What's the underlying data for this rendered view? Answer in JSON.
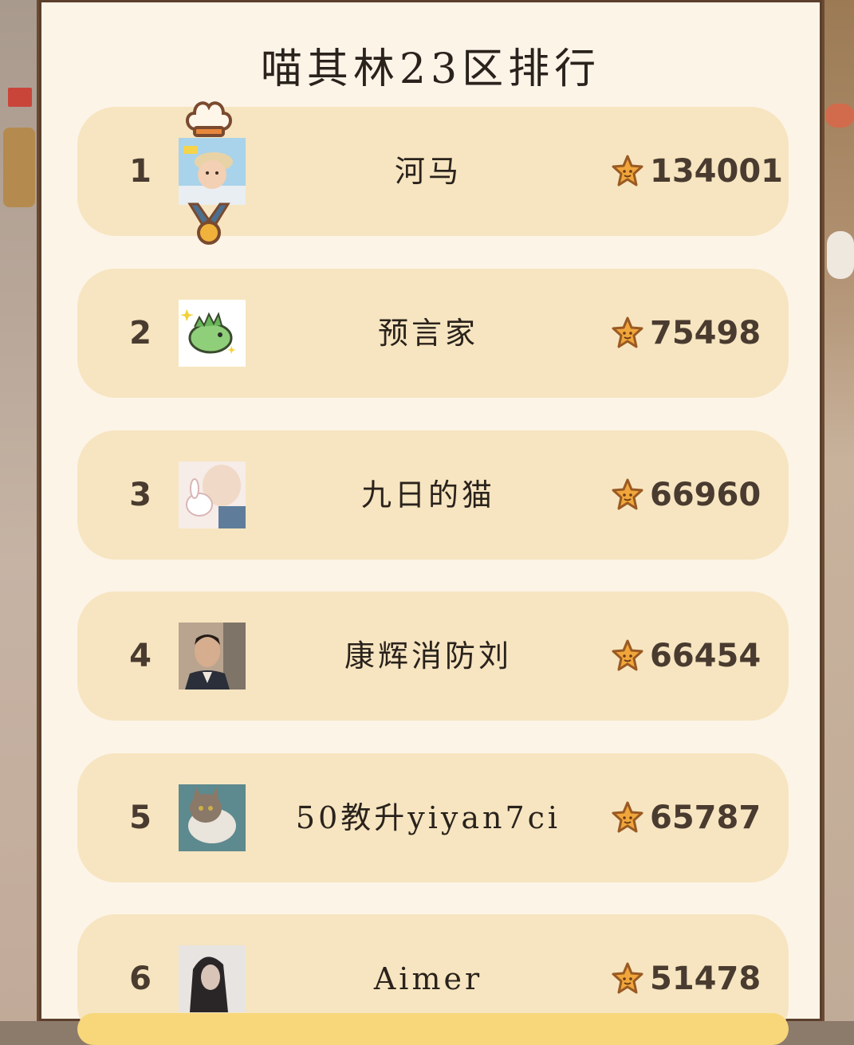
{
  "leaderboard": {
    "title": "喵其林23区排行",
    "entries": [
      {
        "rank": "1",
        "name": "河马",
        "score": "134001",
        "avatar": "baby-photo"
      },
      {
        "rank": "2",
        "name": "预言家",
        "score": "75498",
        "avatar": "cartoon-dinosaur"
      },
      {
        "rank": "3",
        "name": "九日的猫",
        "score": "66960",
        "avatar": "anime-girl-with-rabbit"
      },
      {
        "rank": "4",
        "name": "康辉消防刘",
        "score": "66454",
        "avatar": "man-portrait"
      },
      {
        "rank": "5",
        "name": "50教升yiyan7ci",
        "score": "65787",
        "avatar": "cat-photo"
      },
      {
        "rank": "6",
        "name": "Aimer",
        "score": "51478",
        "avatar": "long-hair-person"
      }
    ]
  },
  "icons": {
    "star": "star-icon",
    "crown": "chef-hat-crown-icon",
    "medal": "gold-medal-icon"
  },
  "colors": {
    "panel_bg": "#fdf4e8",
    "row_bg": "#f6e5c0",
    "star": "#e8a13c",
    "text": "#4a3b30"
  }
}
